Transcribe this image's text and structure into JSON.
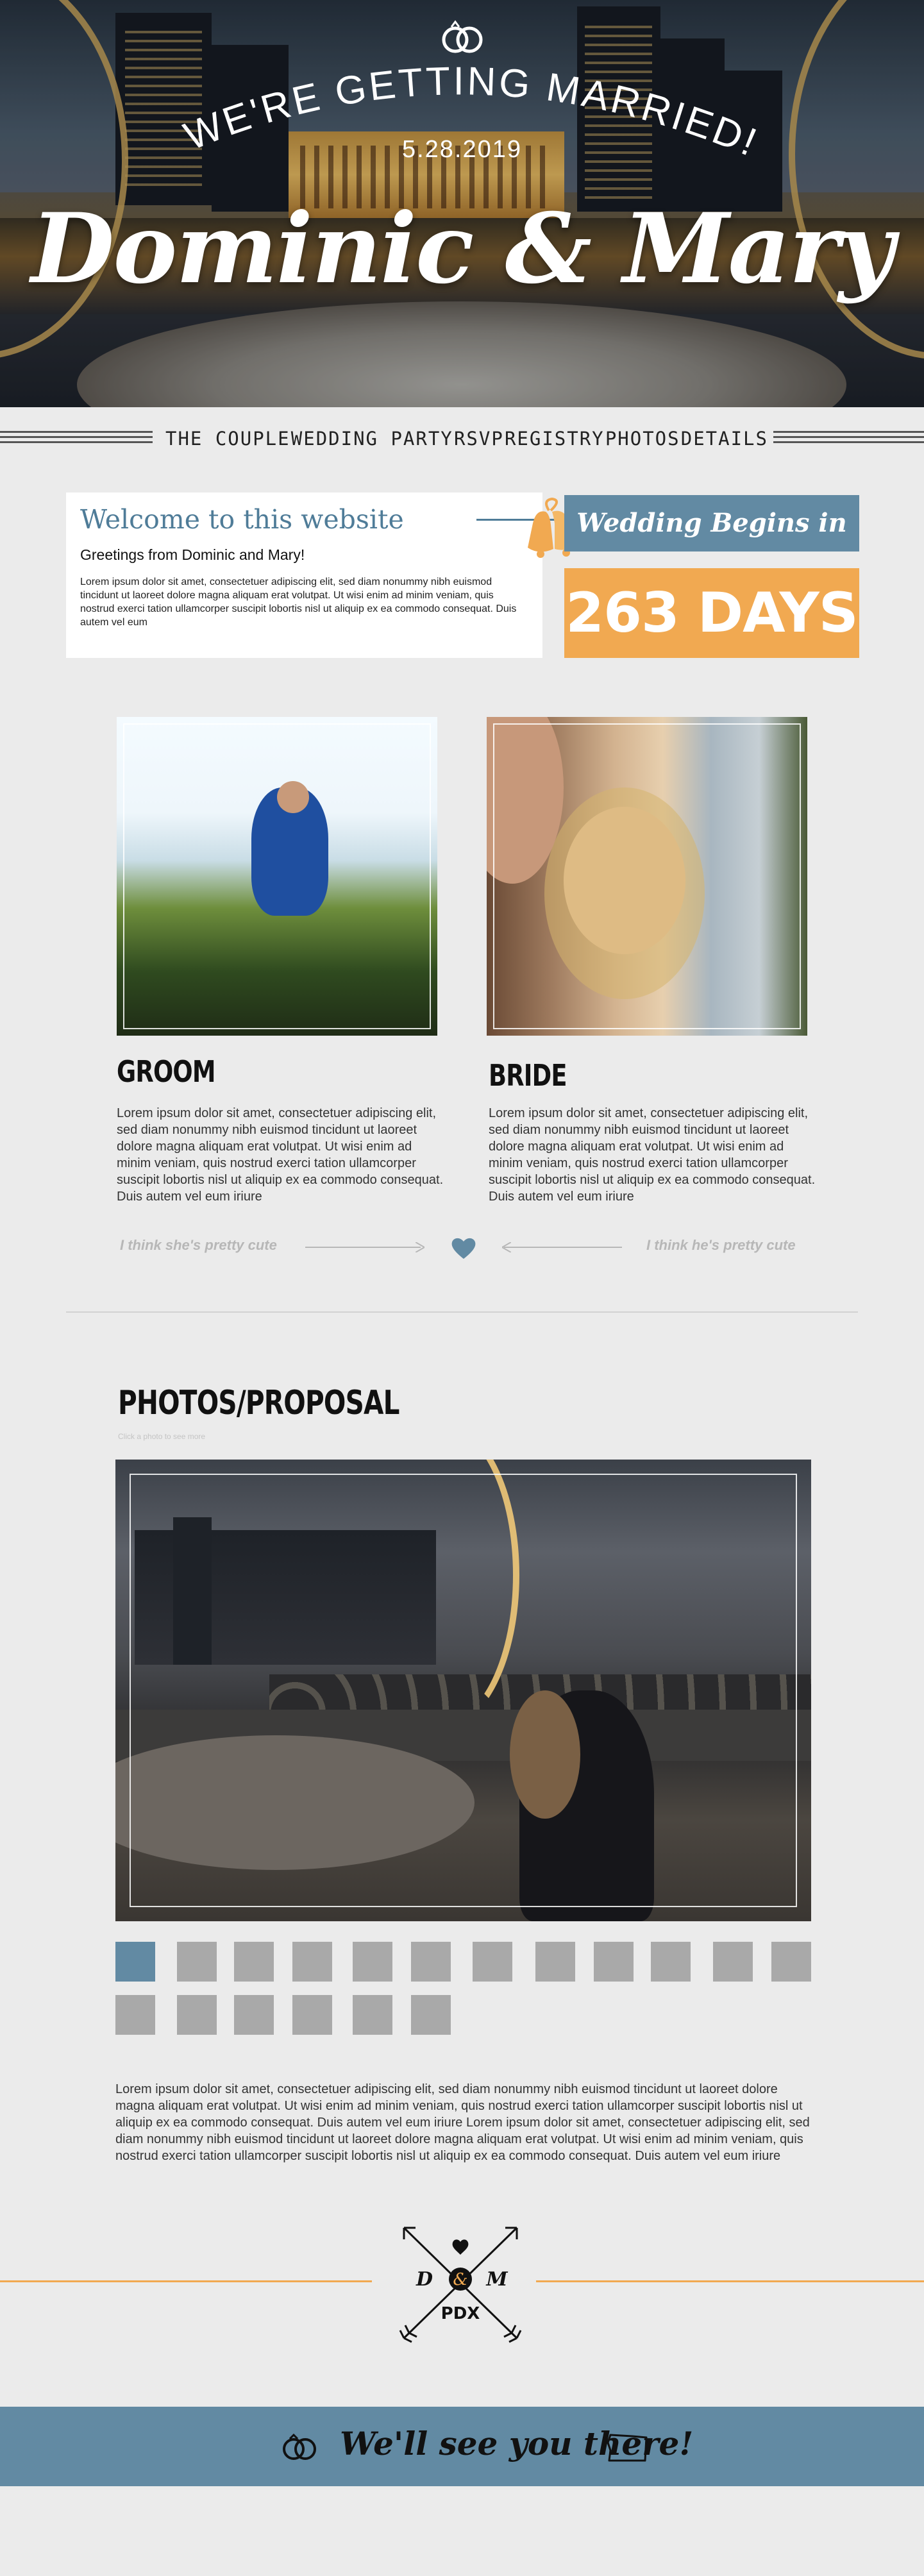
{
  "hero": {
    "announcement": "WE'RE GETTING MARRIED!",
    "date": "5.28.2019",
    "names": "Dominic & Mary"
  },
  "nav": {
    "items": [
      "THE COUPLE",
      "WEDDING PARTY",
      "RSVP",
      "REGISTRY",
      "PHOTOS",
      "DETAILS"
    ]
  },
  "welcome": {
    "title": "Welcome to this website",
    "greeting": "Greetings from Dominic and Mary!",
    "body": "Lorem ipsum dolor sit amet, consectetuer adipiscing elit, sed diam nonummy nibh euismod tincidunt ut laoreet dolore magna aliquam erat volutpat. Ut wisi enim ad minim veniam, quis nostrud exerci tation ullamcorper suscipit lobortis nisl ut aliquip ex ea commodo consequat. Duis autem vel eum"
  },
  "countdown": {
    "label": "Wedding Begins in",
    "value": "263 DAYS"
  },
  "couple": {
    "groom": {
      "heading": "GROOM",
      "bio": "Lorem ipsum dolor sit amet, consectetuer adipiscing elit, sed diam nonummy nibh euismod tincidunt ut laoreet dolore magna aliquam erat volutpat. Ut wisi enim ad minim veniam, quis nostrud exerci tation ullamcorper suscipit lobortis nisl ut aliquip ex ea commodo consequat. Duis autem vel eum iriure",
      "quote": "I think she's pretty cute"
    },
    "bride": {
      "heading": "BRIDE",
      "bio": "Lorem ipsum dolor sit amet, consectetuer adipiscing elit, sed diam nonummy nibh euismod tincidunt ut laoreet dolore magna aliquam erat volutpat. Ut wisi enim ad minim veniam, quis nostrud exerci tation ullamcorper suscipit lobortis nisl ut aliquip ex ea commodo consequat. Duis autem vel eum iriure",
      "quote": "I think he's pretty cute"
    }
  },
  "photos": {
    "heading": "PHOTOS/PROPOSAL",
    "hint": "Click a photo to see more",
    "thumbnail_count": 18,
    "active_index": 0,
    "paragraph": "Lorem ipsum dolor sit amet, consectetuer adipiscing elit, sed diam nonummy nibh euismod tincidunt ut laoreet dolore magna aliquam erat volutpat. Ut wisi enim ad minim veniam, quis nostrud exerci tation ullamcorper suscipit lobortis nisl ut aliquip ex ea commodo consequat. Duis autem vel eum iriure Lorem ipsum dolor sit amet, consectetuer adipiscing elit, sed diam nonummy nibh euismod tincidunt ut laoreet dolore magna aliquam erat volutpat. Ut wisi enim ad minim veniam, quis nostrud exerci tation ullamcorper suscipit lobortis nisl ut aliquip ex ea commodo consequat. Duis autem vel eum iriure"
  },
  "logo": {
    "left_initial": "D",
    "ampersand": "&",
    "right_initial": "M",
    "city": "PDX"
  },
  "footer": {
    "text": "We'll see you there!"
  },
  "colors": {
    "accent_blue": "#628aa3",
    "accent_orange": "#f1a951",
    "background": "#ebebeb"
  },
  "icons": [
    "rings-icon",
    "bells-icon",
    "heart-icon",
    "arrows-icon",
    "oregon-state-icon"
  ]
}
